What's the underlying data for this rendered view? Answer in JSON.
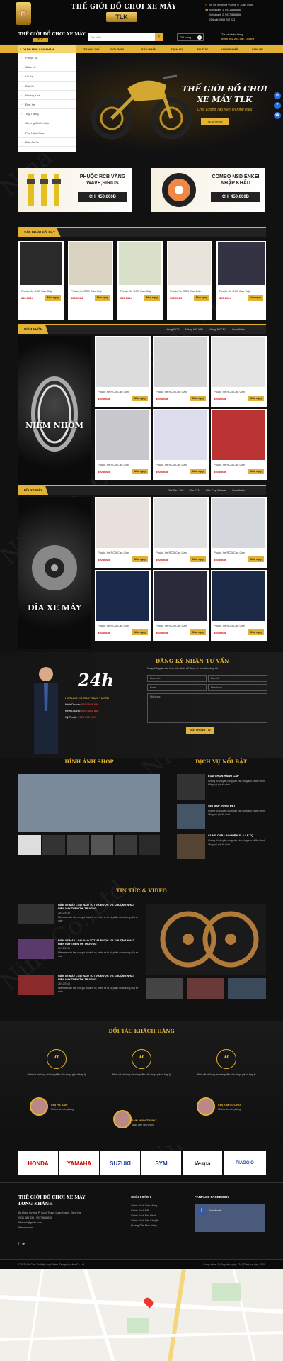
{
  "header": {
    "brand_title": "THẾ GIỚI ĐỒ CHƠI XE MÁY",
    "brand_tlk": "TLK",
    "logo_text": "Anh Tiến",
    "address": "Trụ sở: 8A Hùng Vương, P. Xuân Trung",
    "phone1": "Kinh doanh 1: 0931 888 836",
    "phone2": "Kinh doanh 2: 0937 888 836",
    "phone3": "Kỹ thuật: 0965 202 223"
  },
  "subbar": {
    "brand": "THẾ GIỚI ĐỒ CHƠI XE MÁY",
    "brand_tlk": "TLK",
    "search_placeholder": "Tìm kiếm...",
    "cart_label": "Giỏ hàng",
    "cart_count": "0",
    "hotline_label": "Tư vấn bán hàng",
    "hotline_value": "0965 202 223 (Mr. Thịnh)"
  },
  "nav": {
    "category_label": "DANH MỤC SẢN PHẨM",
    "items": [
      "TRANG CHỦ",
      "GIỚI THIỆU",
      "SẢN PHẨM",
      "DỊCH VỤ",
      "TIN TỨC",
      "KHUYẾN MÃI",
      "LIÊN HỆ"
    ]
  },
  "sidebar": {
    "items": [
      "Phuộc Xe",
      "Mâm Xe",
      "Vỏ Xe",
      "Dĩa Xe",
      "Nhông Xích",
      "Đèn Xe",
      "Tay Thắng",
      "Gương Chiếu Hậu",
      "Phụ Kiện Khác",
      "Dàn Áo Xe"
    ]
  },
  "banner": {
    "title_line1": "THẾ GIỚI ĐỒ CHƠI",
    "title_line2": "XE MÁY TLK",
    "subtitle": "Chất Lượng Tạo Nên Thương Hiệu",
    "cta": "XEM THÊM"
  },
  "promo": [
    {
      "title": "PHUỘC RCB VÀNG WAVE,SIRIUS",
      "price": "CHỈ 450.000Đ"
    },
    {
      "title": "COMBO NSD ENKEI NHẬP KHẨU",
      "price": "CHỈ 450.000Đ"
    }
  ],
  "featured": {
    "title": "SẢN PHẨM NỔI BẬT",
    "products": [
      {
        "name": "Phuộc Xe RCB Cao Cấp",
        "price": "350.000đ",
        "btn": "Mua ngay"
      },
      {
        "name": "Phuộc Xe RCB Cao Cấp",
        "price": "350.000đ",
        "btn": "Mua ngay"
      },
      {
        "name": "Phuộc Xe RCB Cao Cấp",
        "price": "350.000đ",
        "btn": "Mua ngay"
      },
      {
        "name": "Phuộc Xe RCB Cao Cấp",
        "price": "350.000đ",
        "btn": "Mua ngay"
      },
      {
        "name": "Phuộc Xe RCB Cao Cấp",
        "price": "350.000đ",
        "btn": "Mua ngay"
      }
    ]
  },
  "rims": {
    "title": "NIỀM NHÔM",
    "image_label": "NIỀM NHÔM",
    "tabs": [
      "Niềng RCB",
      "Niềng KS-X86",
      "Niềng EXCEL",
      "Xem thêm"
    ],
    "products": [
      {
        "name": "Phuộc Xe RCB Cao Cấp",
        "price": "350.000đ",
        "btn": "Mua ngay"
      },
      {
        "name": "Phuộc Xe RCB Cao Cấp",
        "price": "350.000đ",
        "btn": "Mua ngay"
      },
      {
        "name": "Phuộc Xe RCB Cao Cấp",
        "price": "350.000đ",
        "btn": "Mua ngay"
      },
      {
        "name": "Phuộc Xe RCB Cao Cấp",
        "price": "350.000đ",
        "btn": "Mua ngay"
      },
      {
        "name": "Phuộc Xe RCB Cao Cấp",
        "price": "350.000đ",
        "btn": "Mua ngay"
      },
      {
        "name": "Phuộc Xe RCB Cao Cấp",
        "price": "350.000đ",
        "btn": "Mua ngay"
      }
    ]
  },
  "discs": {
    "title": "ĐĨA XE MÁY",
    "image_label": "ĐĨA XE MÁY",
    "tabs": [
      "Đĩa Sau 245",
      "Đĩa KTM",
      "Đĩa Cặp Winner",
      "Xem thêm"
    ],
    "products": [
      {
        "name": "Phuộc Xe RCB Cao Cấp",
        "price": "350.000đ",
        "btn": "Mua ngay"
      },
      {
        "name": "Phuộc Xe RCB Cao Cấp",
        "price": "350.000đ",
        "btn": "Mua ngay"
      },
      {
        "name": "Phuộc Xe RCB Cao Cấp",
        "price": "350.000đ",
        "btn": "Mua ngay"
      },
      {
        "name": "Phuộc Xe RCB Cao Cấp",
        "price": "350.000đ",
        "btn": "Mua ngay"
      },
      {
        "name": "Phuộc Xe RCB Cao Cấp",
        "price": "350.000đ",
        "btn": "Mua ngay"
      },
      {
        "name": "Phuộc Xe RCB Cao Cấp",
        "price": "350.000đ",
        "btn": "Mua ngay"
      }
    ]
  },
  "consult": {
    "title": "ĐĂNG KÝ NHẬN TƯ VẤN",
    "subtitle": "Nhập thông tin vào form bên dưới để được tư vấn từ chúng tôi",
    "ph_name": "Họ và tên",
    "ph_address": "Địa chỉ",
    "ph_email": "Email",
    "ph_phone": "Điện thoại",
    "ph_content": "Nội dung",
    "submit": "GỬI THÔNG TIN",
    "badge": "24h",
    "hotline_title": "HOTLINE HỖ TRỢ TRỰC TUYẾN",
    "kd1_label": "Kinh Doanh:",
    "kd1": "0931 888 836",
    "kd2_label": "Kinh Doanh:",
    "kd2": "0937 888 836",
    "kt_label": "Kỹ Thuật:",
    "kt": "0965 202 223"
  },
  "gallery": {
    "title": "HÌNH ẢNH SHOP"
  },
  "services": {
    "title": "DỊCH VỤ NỔI BẬT",
    "items": [
      {
        "title": "LỰA CHỌN HÀNG CẤP",
        "desc": "Chúng tôi chuyên cung cấp các dòng sản phẩm chính hãng với giá tốt nhất"
      },
      {
        "title": "SETMAP ĐỘNG ĐẸT",
        "desc": "Chúng tôi chuyên cung cấp các dòng sản phẩm chính hãng với giá tốt nhất"
      },
      {
        "title": "CUNG CẤP LINH KIỆN SỈ & LẺ TQ",
        "desc": "Chúng tôi chuyên cung cấp các dòng sản phẩm chính hãng với giá tốt nhất"
      }
    ]
  },
  "news": {
    "title": "TIN TỨC & VIDEO",
    "items": [
      {
        "title": "NÂM XE MÁY LOẠI NÀO TỐT VÀ ĐƯỢC ƯA CHUỘNG NHẤT HIỆN NAY TRÊN THỊ TRƯỜNG",
        "date": "29/12/2019",
        "desc": "Niềm xe máy hay còn gọi là vành xe, mâm xe là bộ phận quan trọng của xe máy"
      },
      {
        "title": "NÂM XE MÁY LOẠI NÀO TỐT VÀ ĐƯỢC ƯA CHUỘNG NHẤT HIỆN NAY TRÊN THỊ TRƯỜNG",
        "date": "29/12/2019",
        "desc": "Niềm xe máy hay còn gọi là vành xe, mâm xe là bộ phận quan trọng của xe máy"
      },
      {
        "title": "NÂM XE MÁY LOẠI NÀO TỐT VÀ ĐƯỢC ƯA CHUỘNG NHẤT HIỆN NAY TRÊN THỊ TRƯỜNG",
        "date": "29/12/2019",
        "desc": "Niềm xe máy hay còn gọi là vành xe, mâm xe là bộ phận quan trọng của xe máy"
      }
    ]
  },
  "partners": {
    "title": "ĐỐI TÁC KHÁCH HÀNG",
    "testimonials": [
      {
        "text": "Mình rất hài lòng với sản phẩm của shop, giá cả hợp lý",
        "name": "CHỊ HÀ ANH",
        "role": "Nhân viên văn phòng"
      },
      {
        "text": "Mình rất hài lòng với sản phẩm của shop, giá cả hợp lý",
        "name": "ANH MINH TRUNG",
        "role": "Nhân viên văn phòng"
      },
      {
        "text": "Mình rất hài lòng với sản phẩm của shop, giá cả hợp lý",
        "name": "CHỊ KIM CƯƠNG",
        "role": "Nhân viên văn phòng"
      }
    ],
    "logos": [
      "HONDA",
      "YAMAHA",
      "SUZUKI",
      "SYM",
      "Vespa",
      "PIAGGIO"
    ]
  },
  "footer": {
    "brand": "THẾ GIỚI ĐỒ CHƠI XE MÁY",
    "brand2": "LONG KHÁNH",
    "address": "8A Hùng Vương, P. Xuân Trung, Long Khánh, Đồng Nai",
    "phone": "0931 888 836 - 0937 888 836",
    "email": "tlkmotor@gmail.com",
    "web": "tlkmotor.com",
    "policy_title": "CHÍNH SÁCH",
    "policies": [
      "Chính Sách Giao Hàng",
      "Chính Sách Đổi",
      "Chính Sách Bảo Hành",
      "Chính Sách Vận Chuyển",
      "Hướng Dẫn Mua Hàng"
    ],
    "fb_title": "FANPAGE FACEBOOK",
    "fb_label": "Facebook",
    "copyright": "© 2020 Đồ Chơi Xe Máy Long Khánh. Design by Nina Co.,Ltd",
    "stats": "Đang online: 5 | Truy cập ngày: 120 | Tổng truy cập: 2000"
  },
  "watermark": "Nina Co.,Ltd",
  "colors": {
    "accent": "#e3b234",
    "background": "#111111"
  }
}
